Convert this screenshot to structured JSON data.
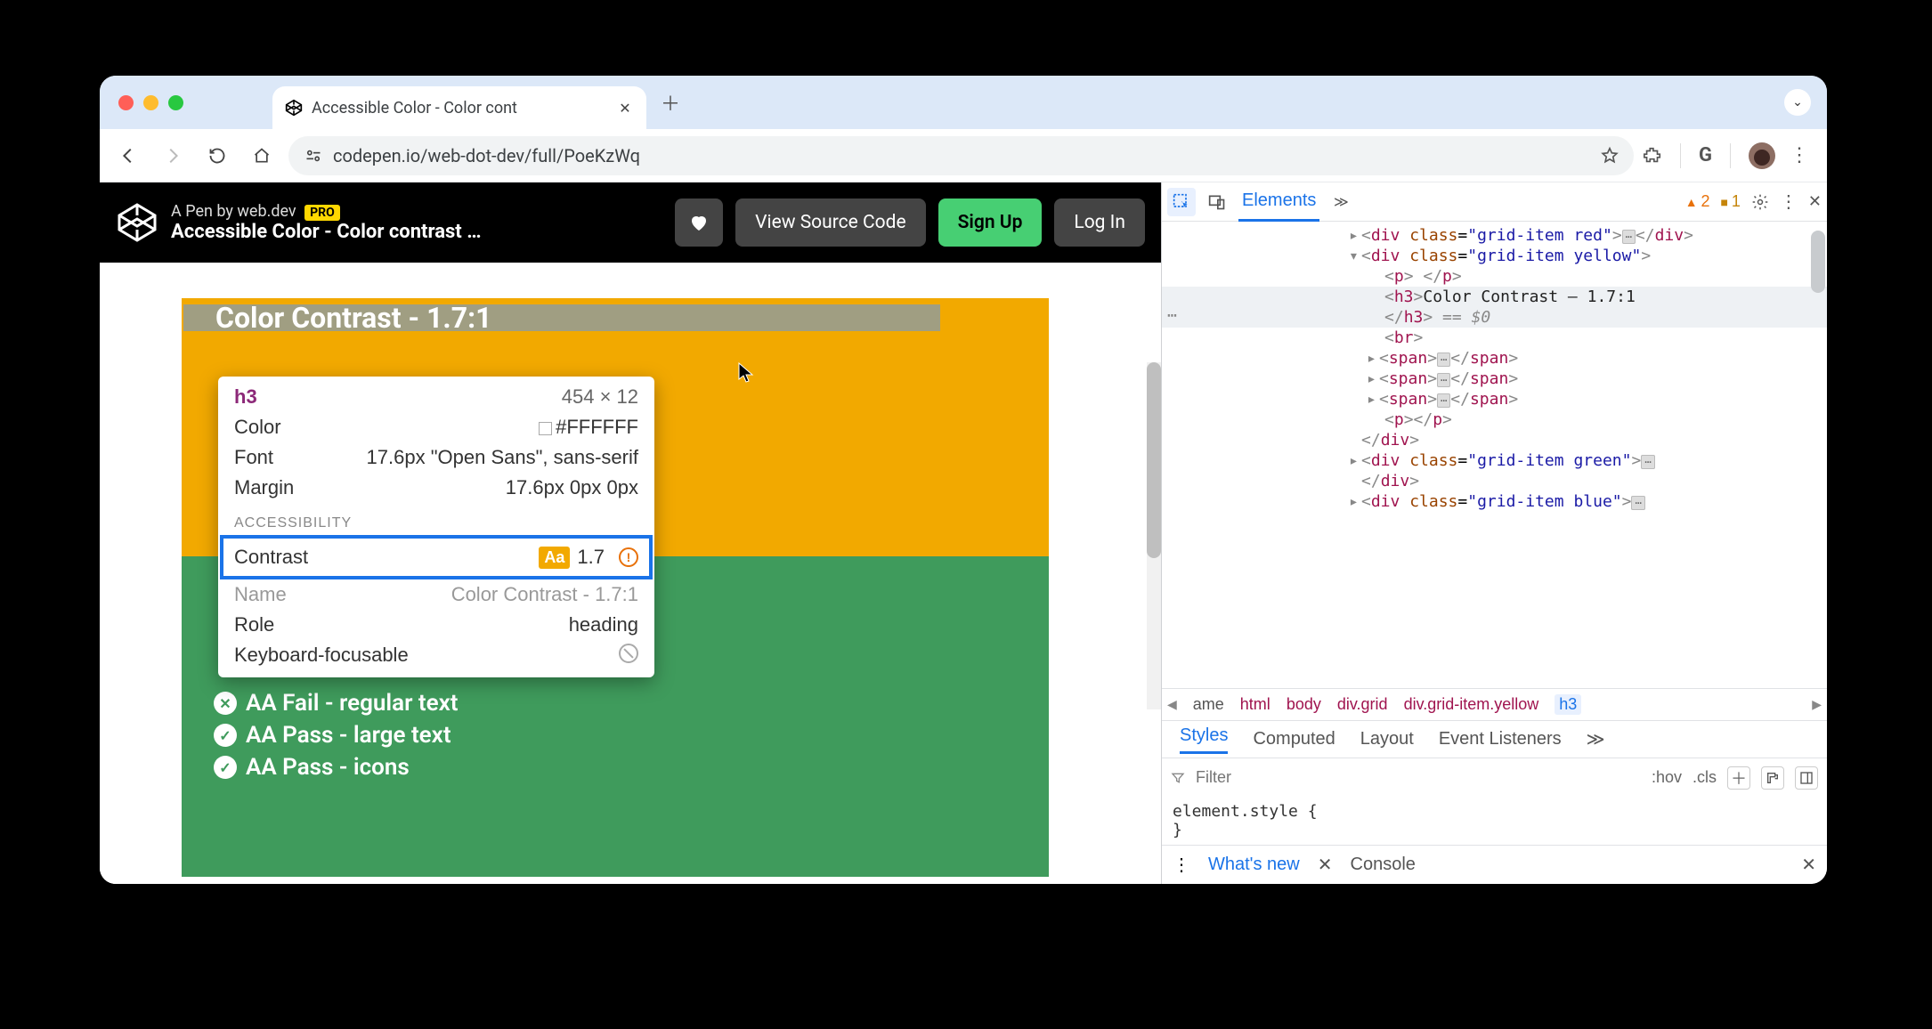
{
  "browser": {
    "tab_title": "Accessible Color - Color cont",
    "url": "codepen.io/web-dot-dev/full/PoeKzWq"
  },
  "codepen": {
    "byline_prefix": "A Pen by ",
    "byline_author": "web.dev",
    "pro_badge": "PRO",
    "title": "Accessible Color - Color contrast …",
    "view_source": "View Source Code",
    "sign_up": "Sign Up",
    "log_in": "Log In"
  },
  "page": {
    "yellow_heading": "Color Contrast - 1.7:1",
    "green_items": [
      {
        "status": "fail",
        "text": "AA Fail - regular text"
      },
      {
        "status": "pass",
        "text": "AA Pass - large text"
      },
      {
        "status": "pass",
        "text": "AA Pass - icons"
      }
    ]
  },
  "inspector_tooltip": {
    "tag": "h3",
    "dimensions": "454 × 12",
    "rows": [
      {
        "k": "Color",
        "v": "#FFFFFF",
        "swatch": true
      },
      {
        "k": "Font",
        "v": "17.6px \"Open Sans\", sans-serif"
      },
      {
        "k": "Margin",
        "v": "17.6px 0px 0px"
      }
    ],
    "section": "ACCESSIBILITY",
    "contrast_label": "Contrast",
    "contrast_aa": "Aa",
    "contrast_value": "1.7",
    "name_label": "Name",
    "name_value": "Color Contrast - 1.7:1",
    "role_label": "Role",
    "role_value": "heading",
    "kb_label": "Keyboard-focusable"
  },
  "devtools": {
    "tabs": {
      "elements": "Elements"
    },
    "warn_count": "2",
    "issue_count": "1",
    "dom": {
      "red": "grid-item red",
      "yellow": "grid-item yellow",
      "h3_text": "Color Contrast – 1.7:1",
      "eq": " == $0",
      "green": "grid-item green",
      "blue": "grid-item blue"
    },
    "breadcrumb": [
      "ame",
      "html",
      "body",
      "div.grid",
      "div.grid-item.yellow",
      "h3"
    ],
    "styles_tabs": [
      "Styles",
      "Computed",
      "Layout",
      "Event Listeners"
    ],
    "filter_placeholder": "Filter",
    "hov": ":hov",
    "cls": ".cls",
    "element_style": "element.style {",
    "element_style_close": "}",
    "drawer": {
      "whats_new": "What's new",
      "console": "Console"
    }
  }
}
